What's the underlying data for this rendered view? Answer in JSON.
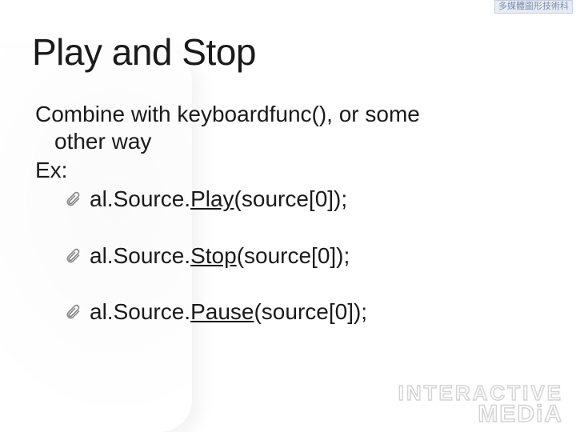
{
  "badge_top": "多媒體圖形技術科",
  "title": "Play and Stop",
  "intro_line1": "Combine with keyboardfunc(), or some",
  "intro_line2": "other way",
  "ex_label": "Ex:",
  "items": [
    {
      "pre": "al.Source.",
      "em": "Play",
      "post": "(source[0]);"
    },
    {
      "pre": "al.Source.",
      "em": "Stop",
      "post": "(source[0]);"
    },
    {
      "pre": "al.Source.",
      "em": "Pause",
      "post": "(source[0]);"
    }
  ],
  "watermark": {
    "line1": "INTERACTIVE",
    "line2": "MEDiA"
  }
}
